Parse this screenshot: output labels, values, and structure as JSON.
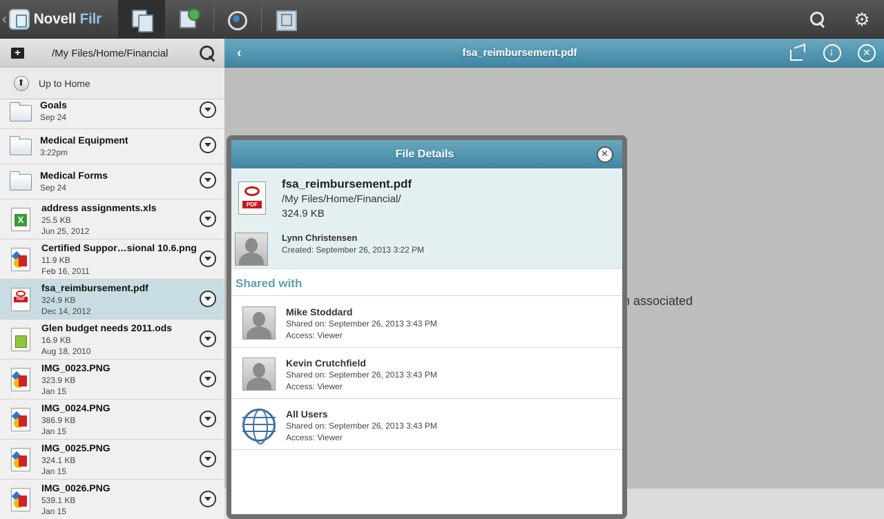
{
  "app": {
    "brand_name": "Novell",
    "brand_suffix": "Filr",
    "back_glyph": "‹"
  },
  "topnav": {
    "tabs": [
      {
        "name": "my-files-tab",
        "icon": "documents-icon",
        "active": true
      },
      {
        "name": "shared-with-me-tab",
        "icon": "shared-icon",
        "active": false
      },
      {
        "name": "whats-new-tab",
        "icon": "whats-new-icon",
        "active": false
      },
      {
        "name": "net-folders-tab",
        "icon": "net-folders-icon",
        "active": false
      }
    ],
    "search_icon": "search-icon",
    "settings_icon": "gear-icon"
  },
  "leftpanel": {
    "path": "/My Files/Home/Financial",
    "up_label": "Up to Home",
    "items": [
      {
        "type": "folder",
        "title": "Goals",
        "sub": "Sep 24"
      },
      {
        "type": "folder",
        "title": "Medical Equipment",
        "sub": "3:22pm"
      },
      {
        "type": "folder",
        "title": "Medical Forms",
        "sub": "Sep 24"
      },
      {
        "type": "xls",
        "title": "address assignments.xls",
        "size": "25.5 KB",
        "date": "Jun 25, 2012"
      },
      {
        "type": "img",
        "title": "Certified Suppor…sional 10.6.png",
        "size": "11.9 KB",
        "date": "Feb 16, 2011"
      },
      {
        "type": "pdf",
        "title": "fsa_reimbursement.pdf",
        "size": "324.9 KB",
        "date": "Dec 14, 2012",
        "selected": true
      },
      {
        "type": "ods",
        "title": "Glen budget needs 2011.ods",
        "size": "16.9 KB",
        "date": "Aug 18, 2010"
      },
      {
        "type": "img",
        "title": "IMG_0023.PNG",
        "size": "323.9 KB",
        "date": "Jan 15"
      },
      {
        "type": "img",
        "title": "IMG_0024.PNG",
        "size": "386.9 KB",
        "date": "Jan 15"
      },
      {
        "type": "img",
        "title": "IMG_0025.PNG",
        "size": "324.1 KB",
        "date": "Jan 15"
      },
      {
        "type": "img",
        "title": "IMG_0026.PNG",
        "size": "539.1 KB",
        "date": "Jan 15"
      }
    ]
  },
  "main": {
    "title": "fsa_reimbursement.pdf",
    "back_glyph": "‹",
    "background_text": "n associated"
  },
  "modal": {
    "title": "File Details",
    "file_name": "fsa_reimbursement.pdf",
    "file_path": "/My Files/Home/Financial/",
    "file_size": "324.9 KB",
    "pdf_label": "PDF",
    "owner": "Lynn Christensen",
    "created": "Created: September 26, 2013 3:22 PM",
    "shared_header": "Shared with",
    "shares": [
      {
        "name": "Mike Stoddard",
        "date": "Shared on: September 26, 2013 3:43 PM",
        "access": "Access: Viewer",
        "kind": "user"
      },
      {
        "name": "Kevin Crutchfield",
        "date": "Shared on: September 26, 2013 3:43 PM",
        "access": "Access: Viewer",
        "kind": "user"
      },
      {
        "name": "All Users",
        "date": "Shared on: September 26, 2013 3:43 PM",
        "access": "Access: Viewer",
        "kind": "group"
      }
    ]
  }
}
